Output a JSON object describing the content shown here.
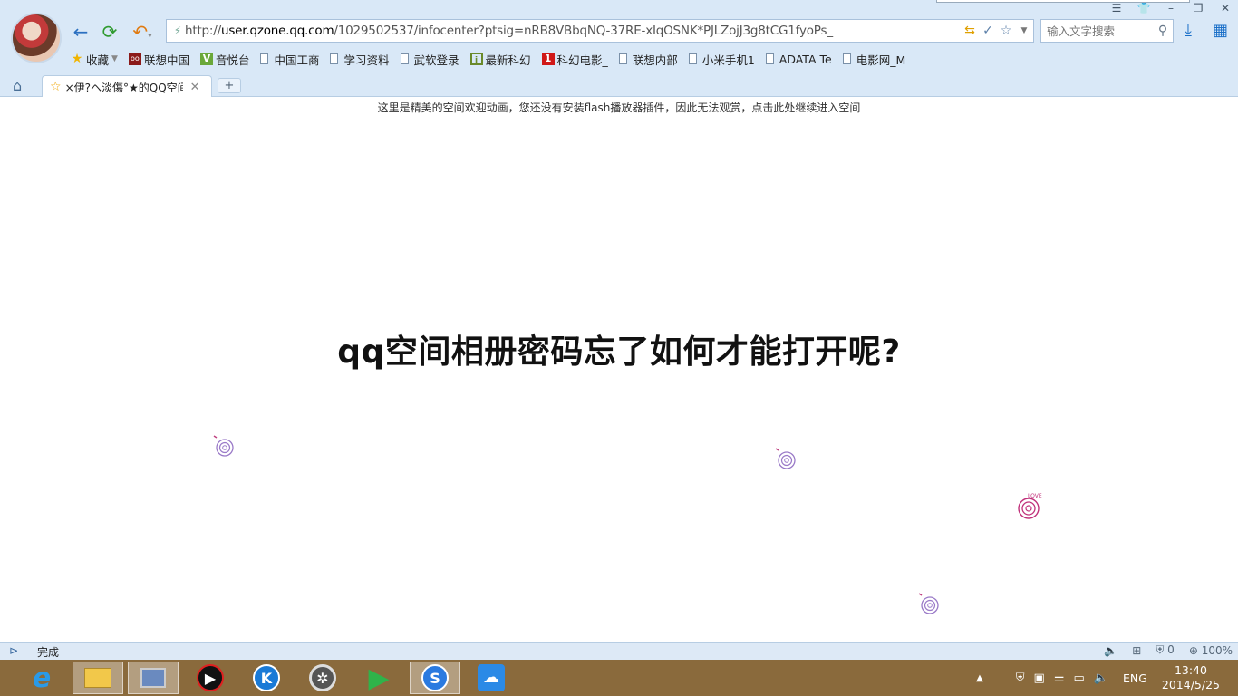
{
  "browser": {
    "url_prefix": "http://",
    "url_host": "user.qzone.qq.com",
    "url_path": "/1029502537/infocenter?ptsig=nRB8VBbqNQ-37RE-xIqOSNK*PJLZojJ3g8tCG1fyoPs_",
    "search_placeholder": "输入文字搜索"
  },
  "bookmarks": {
    "favorites": "收藏",
    "items": [
      {
        "label": "联想中国",
        "icon": "lenovo-icon"
      },
      {
        "label": "音悦台",
        "icon": "yinyuetai-icon"
      },
      {
        "label": "中国工商",
        "icon": "page-icon"
      },
      {
        "label": "学习资料",
        "icon": "page-icon"
      },
      {
        "label": "武软登录",
        "icon": "page-icon"
      },
      {
        "label": "最新科幻",
        "icon": "green-page-icon"
      },
      {
        "label": "科幻电影_",
        "icon": "red-page-icon"
      },
      {
        "label": "联想内部",
        "icon": "page-icon"
      },
      {
        "label": "小米手机1",
        "icon": "page-icon"
      },
      {
        "label": "ADATA Te",
        "icon": "page-icon"
      },
      {
        "label": "电影网_M",
        "icon": "page-icon"
      }
    ]
  },
  "tab": {
    "title": "×伊?ヘ淡傷°★的QQ空间",
    "new_tab": "+"
  },
  "page": {
    "flash_notice": "这里是精美的空间欢迎动画，您还没有安装flash播放器插件，因此无法观赏，点击此处继续进入空间",
    "headline": "qq空间相册密码忘了如何才能打开呢?",
    "love_text": "LOVE"
  },
  "status": {
    "text": "完成",
    "counter": "0",
    "zoom": "100%"
  },
  "taskbar": {
    "lang": "ENG",
    "time": "13:40",
    "date": "2014/5/25"
  }
}
